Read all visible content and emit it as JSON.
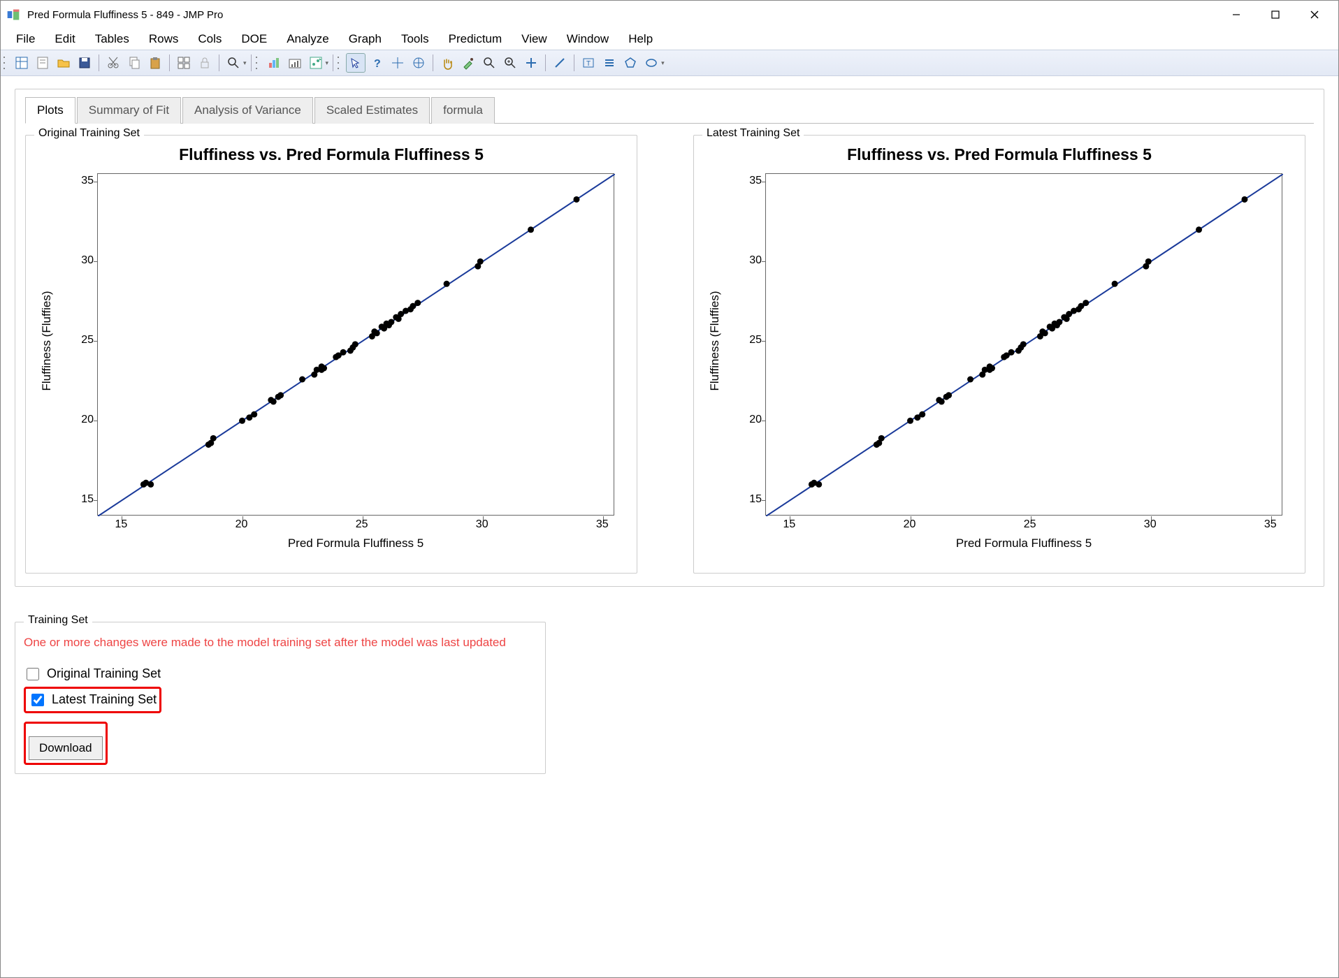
{
  "window": {
    "title": "Pred Formula Fluffiness 5 - 849 - JMP Pro"
  },
  "menu": [
    "File",
    "Edit",
    "Tables",
    "Rows",
    "Cols",
    "DOE",
    "Analyze",
    "Graph",
    "Tools",
    "Predictum",
    "View",
    "Window",
    "Help"
  ],
  "tabs": [
    "Plots",
    "Summary of Fit",
    "Analysis of Variance",
    "Scaled Estimates",
    "formula"
  ],
  "active_tab": "Plots",
  "panels": {
    "left": "Original Training Set",
    "right": "Latest Training Set"
  },
  "training_set": {
    "legend": "Training Set",
    "warning": "One or more changes were made to the model training set after the model was last updated",
    "opt_original": "Original Training Set",
    "opt_latest": "Latest Training Set",
    "original_checked": false,
    "latest_checked": true,
    "download": "Download"
  },
  "chart_data": [
    {
      "type": "scatter",
      "panel": "Original Training Set",
      "title": "Fluffiness vs. Pred Formula Fluffiness 5",
      "xlabel": "Pred Formula Fluffiness 5",
      "ylabel": "Fluffiness (Fluffies)",
      "xlim": [
        14,
        35.5
      ],
      "ylim": [
        14,
        35.5
      ],
      "xticks": [
        15,
        20,
        25,
        30,
        35
      ],
      "yticks": [
        15,
        20,
        25,
        30,
        35
      ],
      "fit_line": {
        "x0": 14,
        "y0": 14,
        "x1": 35.5,
        "y1": 35.5
      },
      "series": [
        {
          "name": "data",
          "x": [
            15.9,
            16.0,
            16.2,
            18.6,
            18.7,
            18.8,
            20.0,
            20.3,
            20.5,
            21.2,
            21.3,
            21.5,
            21.6,
            22.5,
            23.0,
            23.1,
            23.3,
            23.3,
            23.4,
            23.9,
            24.0,
            24.2,
            24.5,
            24.6,
            24.7,
            25.4,
            25.5,
            25.6,
            25.8,
            25.9,
            26.0,
            26.1,
            26.2,
            26.4,
            26.5,
            26.6,
            26.8,
            27.0,
            27.1,
            27.3,
            28.5,
            29.8,
            29.9,
            32.0,
            33.9
          ],
          "y": [
            16.0,
            16.1,
            16.0,
            18.5,
            18.6,
            18.9,
            20.0,
            20.2,
            20.4,
            21.3,
            21.2,
            21.5,
            21.6,
            22.6,
            22.9,
            23.2,
            23.2,
            23.4,
            23.3,
            24.0,
            24.1,
            24.3,
            24.4,
            24.6,
            24.8,
            25.3,
            25.6,
            25.5,
            25.9,
            25.8,
            26.1,
            26.0,
            26.2,
            26.5,
            26.4,
            26.7,
            26.9,
            27.0,
            27.2,
            27.4,
            28.6,
            29.7,
            30.0,
            32.0,
            33.9
          ]
        }
      ]
    },
    {
      "type": "scatter",
      "panel": "Latest Training Set",
      "title": "Fluffiness vs. Pred Formula Fluffiness 5",
      "xlabel": "Pred Formula Fluffiness 5",
      "ylabel": "Fluffiness (Fluffies)",
      "xlim": [
        14,
        35.5
      ],
      "ylim": [
        14,
        35.5
      ],
      "xticks": [
        15,
        20,
        25,
        30,
        35
      ],
      "yticks": [
        15,
        20,
        25,
        30,
        35
      ],
      "fit_line": {
        "x0": 14,
        "y0": 14,
        "x1": 35.5,
        "y1": 35.5
      },
      "series": [
        {
          "name": "data",
          "x": [
            15.9,
            16.0,
            16.2,
            18.6,
            18.7,
            18.8,
            20.0,
            20.3,
            20.5,
            21.2,
            21.3,
            21.5,
            21.6,
            22.5,
            23.0,
            23.1,
            23.3,
            23.3,
            23.4,
            23.9,
            24.0,
            24.2,
            24.5,
            24.6,
            24.7,
            25.4,
            25.5,
            25.6,
            25.8,
            25.9,
            26.0,
            26.1,
            26.2,
            26.4,
            26.5,
            26.6,
            26.8,
            27.0,
            27.1,
            27.3,
            28.5,
            29.8,
            29.9,
            32.0,
            33.9
          ],
          "y": [
            16.0,
            16.1,
            16.0,
            18.5,
            18.6,
            18.9,
            20.0,
            20.2,
            20.4,
            21.3,
            21.2,
            21.5,
            21.6,
            22.6,
            22.9,
            23.2,
            23.2,
            23.4,
            23.3,
            24.0,
            24.1,
            24.3,
            24.4,
            24.6,
            24.8,
            25.3,
            25.6,
            25.5,
            25.9,
            25.8,
            26.1,
            26.0,
            26.2,
            26.5,
            26.4,
            26.7,
            26.9,
            27.0,
            27.2,
            27.4,
            28.6,
            29.7,
            30.0,
            32.0,
            33.9
          ]
        }
      ]
    }
  ]
}
